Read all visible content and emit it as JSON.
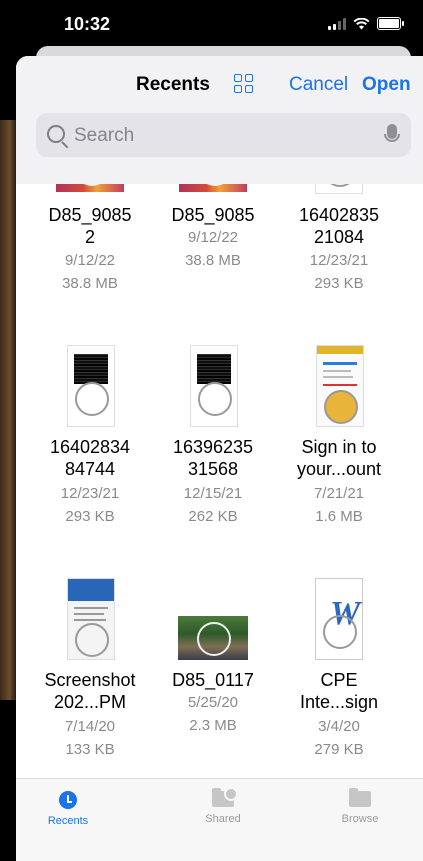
{
  "status": {
    "time": "10:32"
  },
  "header": {
    "title": "Recents",
    "cancel_label": "Cancel",
    "open_label": "Open"
  },
  "search": {
    "placeholder": "Search"
  },
  "files": [
    {
      "name": "D85_9085 2",
      "name_lines": [
        "D85_9085",
        "2"
      ],
      "date": "9/12/22",
      "size": "38.8 MB"
    },
    {
      "name": "D85_9085",
      "name_lines": [
        "D85_9085"
      ],
      "date": "9/12/22",
      "size": "38.8 MB"
    },
    {
      "name": "1640283521084",
      "name_lines": [
        "16402835",
        "21084"
      ],
      "date": "12/23/21",
      "size": "293 KB"
    },
    {
      "name": "1640283484744",
      "name_lines": [
        "16402834",
        "84744"
      ],
      "date": "12/23/21",
      "size": "293 KB"
    },
    {
      "name": "1639623531568",
      "name_lines": [
        "16396235",
        "31568"
      ],
      "date": "12/15/21",
      "size": "262 KB"
    },
    {
      "name": "Sign in to your...ount",
      "name_lines": [
        "Sign in to",
        "your...ount"
      ],
      "date": "7/21/21",
      "size": "1.6 MB"
    },
    {
      "name": "Screenshot 202...PM",
      "name_lines": [
        "Screenshot",
        "202...PM"
      ],
      "date": "7/14/20",
      "size": "133 KB"
    },
    {
      "name": "D85_0117",
      "name_lines": [
        "D85_0117"
      ],
      "date": "5/25/20",
      "size": "2.3 MB"
    },
    {
      "name": "CPE Inte...sign",
      "name_lines": [
        "CPE",
        "Inte...sign"
      ],
      "date": "3/4/20",
      "size": "279 KB"
    }
  ],
  "tabs": [
    {
      "label": "Recents",
      "icon": "clock-icon",
      "active": true
    },
    {
      "label": "Shared",
      "icon": "shared-folder-icon"
    },
    {
      "label": "Browse",
      "icon": "folder-icon"
    }
  ],
  "colors": {
    "accent": "#1a73e8",
    "secondary_text": "#8a8a8e"
  }
}
